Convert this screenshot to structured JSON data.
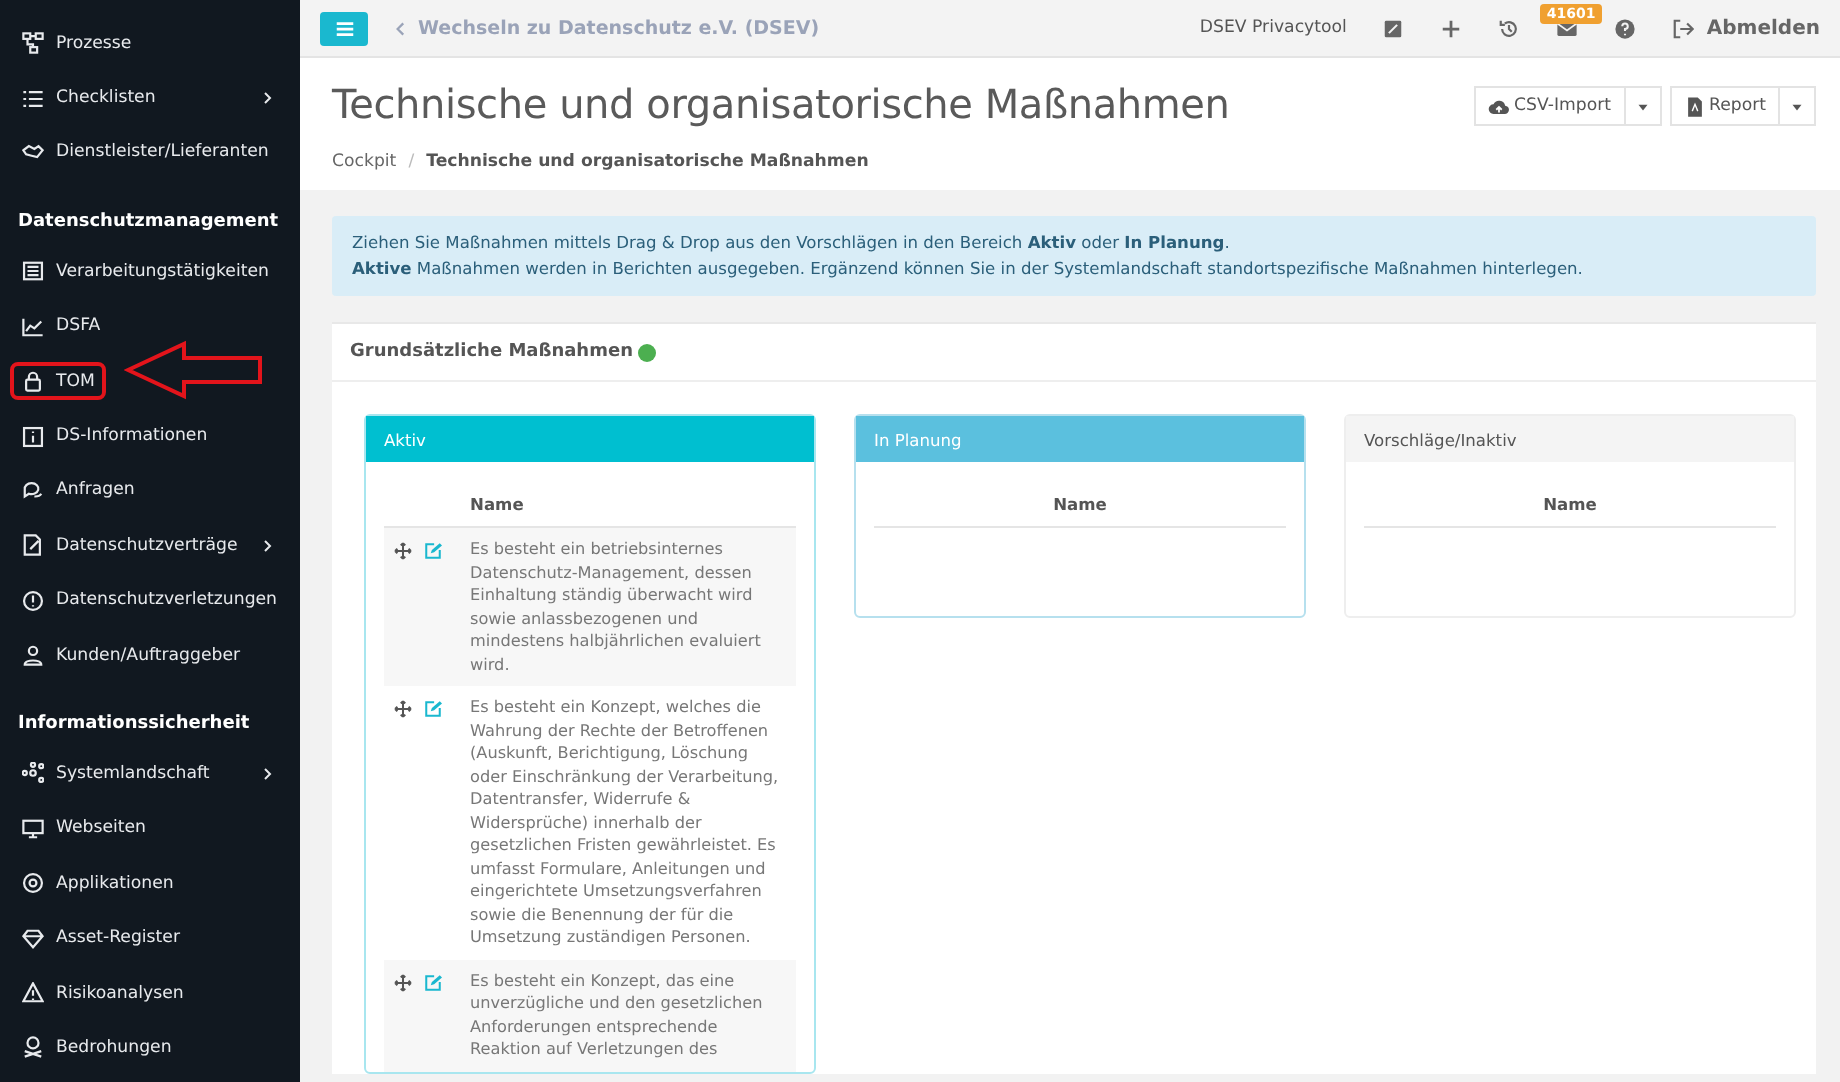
{
  "sidebar": {
    "sections": [
      {
        "items": [
          {
            "label": "Prozesse",
            "has_submenu": false,
            "marked": false
          },
          {
            "label": "Checklisten",
            "has_submenu": true,
            "marked": false
          },
          {
            "label": "Dienstleister/Lieferanten",
            "has_submenu": false,
            "marked": false
          }
        ]
      },
      {
        "heading": "Datenschutzmanagement",
        "items": [
          {
            "label": "Verarbeitungstätigkeiten",
            "has_submenu": false,
            "marked": false
          },
          {
            "label": "DSFA",
            "has_submenu": false,
            "marked": false
          },
          {
            "label": "TOM",
            "has_submenu": false,
            "marked": true
          },
          {
            "label": "DS-Informationen",
            "has_submenu": false,
            "marked": false
          },
          {
            "label": "Anfragen",
            "has_submenu": false,
            "marked": false
          },
          {
            "label": "Datenschutzverträge",
            "has_submenu": true,
            "marked": false
          },
          {
            "label": "Datenschutzverletzungen",
            "has_submenu": false,
            "marked": false
          },
          {
            "label": "Kunden/Auftraggeber",
            "has_submenu": false,
            "marked": false
          }
        ]
      },
      {
        "heading": "Informationssicherheit",
        "items": [
          {
            "label": "Systemlandschaft",
            "has_submenu": true,
            "marked": false
          },
          {
            "label": "Webseiten",
            "has_submenu": false,
            "marked": false
          },
          {
            "label": "Applikationen",
            "has_submenu": false,
            "marked": false
          },
          {
            "label": "Asset-Register",
            "has_submenu": false,
            "marked": false
          },
          {
            "label": "Risikoanalysen",
            "has_submenu": false,
            "marked": false
          },
          {
            "label": "Bedrohungen",
            "has_submenu": false,
            "marked": false
          }
        ]
      }
    ]
  },
  "topbar": {
    "back_link": "Wechseln zu Datenschutz e.V. (DSEV)",
    "app_name": "DSEV Privacytool",
    "mail_badge": "41601",
    "logout": "Abmelden"
  },
  "page": {
    "title": "Technische und organisatorische Maßnahmen",
    "breadcrumb_separator": "/",
    "breadcrumb": [
      "Cockpit",
      "Technische und organisatorische Maßnahmen"
    ],
    "buttons": [
      "CSV-Import",
      "Report"
    ]
  },
  "info": [
    "Ziehen Sie Maßnahmen mittels Drag & Drop aus den Vorschlägen in den Bereich **Aktiv** oder **In Planung**.",
    "**Aktive** Maßnahmen werden in Berichten ausgegeben. Ergänzend können Sie in der Systemlandschaft standortspezifische Maßnahmen hinterlegen."
  ],
  "section": {
    "title": "Grundsätzliche Maßnahmen",
    "complete": true,
    "columns": [
      {
        "title": "Aktiv",
        "kind": "active",
        "header": "Name",
        "rows": [
          "Es besteht ein betriebsinternes Datenschutz-Management, dessen Einhaltung ständig überwacht wird sowie anlassbezogenen und mindestens halbjährlichen evaluiert wird.",
          "Es besteht ein Konzept, welches die Wahrung der Rechte der Betroffenen (Auskunft, Berichtigung, Löschung oder Einschränkung der Verarbeitung, Datentransfer, Widerrufe & Widersprüche) innerhalb der gesetzlichen Fristen gewährleistet. Es umfasst Formulare, Anleitungen und eingerichtete Umsetzungsverfahren sowie die Benennung der für die Umsetzung zuständigen Personen.",
          "Es besteht ein Konzept, das eine unverzügliche und den gesetzlichen Anforderungen entsprechende Reaktion auf Verletzungen des"
        ]
      },
      {
        "title": "In Planung",
        "kind": "planned",
        "header": "Name"
      },
      {
        "title": "Vorschläge/Inaktiv",
        "kind": "inactive",
        "header": "Name"
      }
    ]
  }
}
